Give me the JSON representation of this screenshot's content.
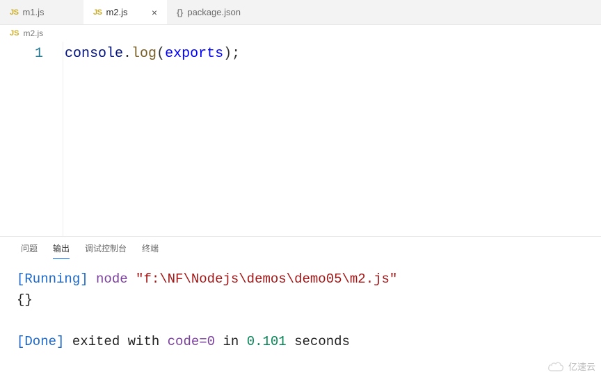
{
  "tabs": [
    {
      "icon": "JS",
      "label": "m1.js",
      "active": false,
      "close": false
    },
    {
      "icon": "JS",
      "label": "m2.js",
      "active": true,
      "close": true
    },
    {
      "icon": "{}",
      "label": "package.json",
      "active": false,
      "close": false
    }
  ],
  "breadcrumb": {
    "icon": "JS",
    "label": "m2.js"
  },
  "editor": {
    "line_number": "1",
    "code": {
      "obj": "console",
      "dot": ".",
      "func": "log",
      "open": "(",
      "arg": "exports",
      "close": ")",
      "semi": ";"
    }
  },
  "panel": {
    "tabs": [
      {
        "label": "问题",
        "active": false
      },
      {
        "label": "输出",
        "active": true
      },
      {
        "label": "调试控制台",
        "active": false
      },
      {
        "label": "终端",
        "active": false
      }
    ],
    "output": {
      "running_tag": "[Running]",
      "running_cmd": "node",
      "running_path": "\"f:\\NF\\Nodejs\\demos\\demo05\\m2.js\"",
      "result": "{}",
      "done_tag": "[Done]",
      "done_prefix": "exited with",
      "done_code_label": "code=",
      "done_code_value": "0",
      "done_mid": "in",
      "done_time": "0.101",
      "done_suffix": "seconds"
    }
  },
  "watermark": "亿速云"
}
